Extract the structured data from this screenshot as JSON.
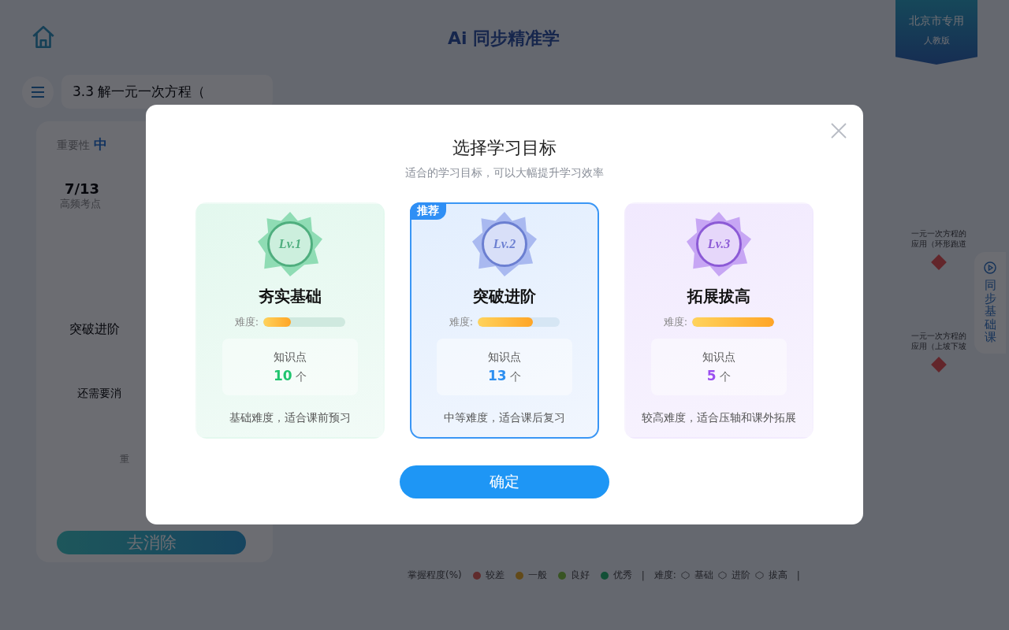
{
  "header": {
    "title": "Ai 同步精准学",
    "region_badge": {
      "line_1": "北京市专用",
      "line_2": "人教版"
    }
  },
  "lesson": {
    "title": "3.3 解一元一次方程（",
    "importance_label": "重要性",
    "importance_value": "中",
    "ratio": "7/13",
    "ratio_label": "高频考点",
    "level_name": "突破进阶",
    "hint": "还需要消",
    "note": "重",
    "action": "去消除"
  },
  "map_nodes": [
    {
      "line_1": "一元一次方程的",
      "line_2": "应用（环形跑道"
    },
    {
      "line_1": "一元一次方程的",
      "line_2": "应用（上坡下坡"
    }
  ],
  "side_tab": {
    "label": "同步基础课"
  },
  "legend": {
    "mastery_label": "掌握程度(%)",
    "mastery": [
      {
        "label": "较差",
        "color": "#602b2c"
      },
      {
        "label": "一般",
        "color": "#624a19"
      },
      {
        "label": "良好",
        "color": "#385423"
      },
      {
        "label": "优秀",
        "color": "#124f36"
      }
    ],
    "separators": [
      "|",
      "|"
    ],
    "difficulty_label": "难度:",
    "difficulty": [
      {
        "label": "基础"
      },
      {
        "label": "进阶"
      },
      {
        "label": "拔高"
      }
    ]
  },
  "dialog": {
    "title": "选择学习目标",
    "subtitle": "适合的学习目标，可以大幅提升学习效率",
    "confirm": "确定",
    "goals": [
      {
        "kind": "green",
        "badge_text": "Lv.1",
        "name": "夯实基础",
        "difficulty_label": "难度:",
        "level": 0.333,
        "points_label": "知识点",
        "points": "10",
        "unit": "个",
        "description": "基础难度，适合课前预习",
        "selected": false
      },
      {
        "kind": "blue",
        "badge_text": "Lv.2",
        "name": "突破进阶",
        "difficulty_label": "难度:",
        "level": 0.667,
        "points_label": "知识点",
        "points": "13",
        "unit": "个",
        "description": "中等难度，适合课后复习",
        "selected": true,
        "tag": "推荐"
      },
      {
        "kind": "purple",
        "badge_text": "Lv.3",
        "name": "拓展拔高",
        "difficulty_label": "难度:",
        "level": 1,
        "points_label": "知识点",
        "points": "5",
        "unit": "个",
        "description": "较高难度，适合压轴和课外拓展",
        "selected": false
      }
    ]
  }
}
